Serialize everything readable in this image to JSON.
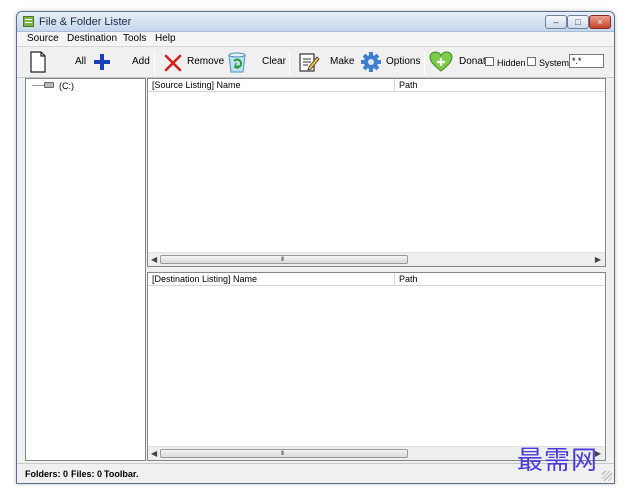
{
  "window": {
    "title": "File & Folder Lister"
  },
  "titlebar_buttons": {
    "minimize": "–",
    "maximize": "□",
    "close": "×"
  },
  "menu": [
    "Source",
    "Destination",
    "Tools",
    "Help"
  ],
  "toolbar": {
    "all_label": "All",
    "add_label": "Add",
    "remove_label": "Remove",
    "clear_label": "Clear",
    "make_label": "Make",
    "options_label": "Options",
    "donate_label": "Donat",
    "hidden_label": "Hidden",
    "system_label": "System",
    "filter_value": "*.*"
  },
  "tree": {
    "drive_label": "(C:)"
  },
  "source_list": {
    "col_name": "[Source Listing] Name",
    "col_path": "Path"
  },
  "destination_list": {
    "col_name": "[Destination Listing] Name",
    "col_path": "Path"
  },
  "scroll": {
    "left": "◀",
    "right": "▶",
    "grip": "III"
  },
  "status": {
    "folders": "Folders: 0",
    "files": "Files: 0",
    "toolbar": "Toolbar."
  },
  "watermark": "最需网",
  "colors": {
    "accent": "#4b3bd8",
    "remove_red": "#d21f1f",
    "add_blue": "#1a3fb8"
  }
}
